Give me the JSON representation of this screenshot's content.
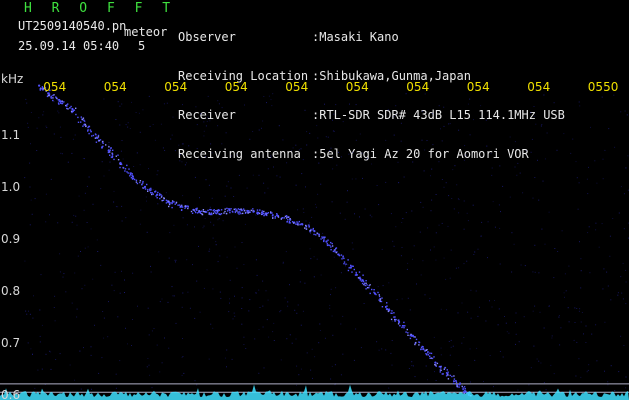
{
  "header": {
    "brand": "H R O F F T",
    "filename": "UT2509140540.pn",
    "mode": "meteor",
    "datetime": "25.09.14 05:40",
    "seconds": "5",
    "info": [
      {
        "label": "Observer",
        "value": ":Masaki Kano"
      },
      {
        "label": "Receiving Location",
        "value": ":Shibukawa,Gunma,Japan"
      },
      {
        "label": "Receiver",
        "value": ":RTL-SDR SDR# 43dB L15 114.1MHz USB"
      },
      {
        "label": "Receiving antenna",
        "value": ":5el Yagi Az 20 for Aomori VOR"
      }
    ]
  },
  "colors": {
    "background": "#000000",
    "header_text": "#e8e8e8",
    "brand": "#3fe23f",
    "tick_labels": "#f0e000",
    "axis_labels": "#d8d8d8",
    "trace": "#5050ff",
    "noise_baseline": "#40e0ff",
    "reference_lines": "#b0b0c8"
  },
  "chart_data": {
    "type": "scatter",
    "title": "",
    "xlabel": "",
    "ylabel": "kHz",
    "x_tick_labels": [
      "054",
      "054",
      "054",
      "054",
      "054",
      "054",
      "054",
      "054",
      "054",
      "0550"
    ],
    "y_tick_labels": [
      "1.1",
      "1.0",
      "0.9",
      "0.8",
      "0.7",
      "0.6"
    ],
    "y_ticks": [
      1.1,
      1.0,
      0.9,
      0.8,
      0.7,
      0.6
    ],
    "ylim": [
      0.59,
      1.2
    ],
    "xlim": [
      0,
      10
    ],
    "reference_lines_y": [
      0.621,
      0.605
    ],
    "series": [
      {
        "points": [
          [
            0.25,
            1.195
          ],
          [
            0.4,
            1.18
          ],
          [
            0.6,
            1.165
          ],
          [
            0.8,
            1.15
          ],
          [
            1.0,
            1.12
          ],
          [
            1.2,
            1.095
          ],
          [
            1.4,
            1.07
          ],
          [
            1.6,
            1.045
          ],
          [
            1.8,
            1.02
          ],
          [
            2.0,
            1.0
          ],
          [
            2.2,
            0.985
          ],
          [
            2.4,
            0.97
          ],
          [
            2.6,
            0.962
          ],
          [
            2.8,
            0.956
          ],
          [
            3.0,
            0.952
          ],
          [
            3.2,
            0.953
          ],
          [
            3.4,
            0.955
          ],
          [
            3.6,
            0.955
          ],
          [
            3.8,
            0.953
          ],
          [
            4.0,
            0.949
          ],
          [
            4.2,
            0.944
          ],
          [
            4.4,
            0.937
          ],
          [
            4.6,
            0.928
          ],
          [
            4.8,
            0.915
          ],
          [
            5.0,
            0.895
          ],
          [
            5.2,
            0.87
          ],
          [
            5.4,
            0.845
          ],
          [
            5.6,
            0.82
          ],
          [
            5.8,
            0.795
          ],
          [
            6.0,
            0.765
          ],
          [
            6.2,
            0.74
          ],
          [
            6.4,
            0.715
          ],
          [
            6.6,
            0.688
          ],
          [
            6.8,
            0.662
          ],
          [
            7.0,
            0.64
          ],
          [
            7.2,
            0.62
          ],
          [
            7.35,
            0.6
          ]
        ]
      }
    ]
  }
}
